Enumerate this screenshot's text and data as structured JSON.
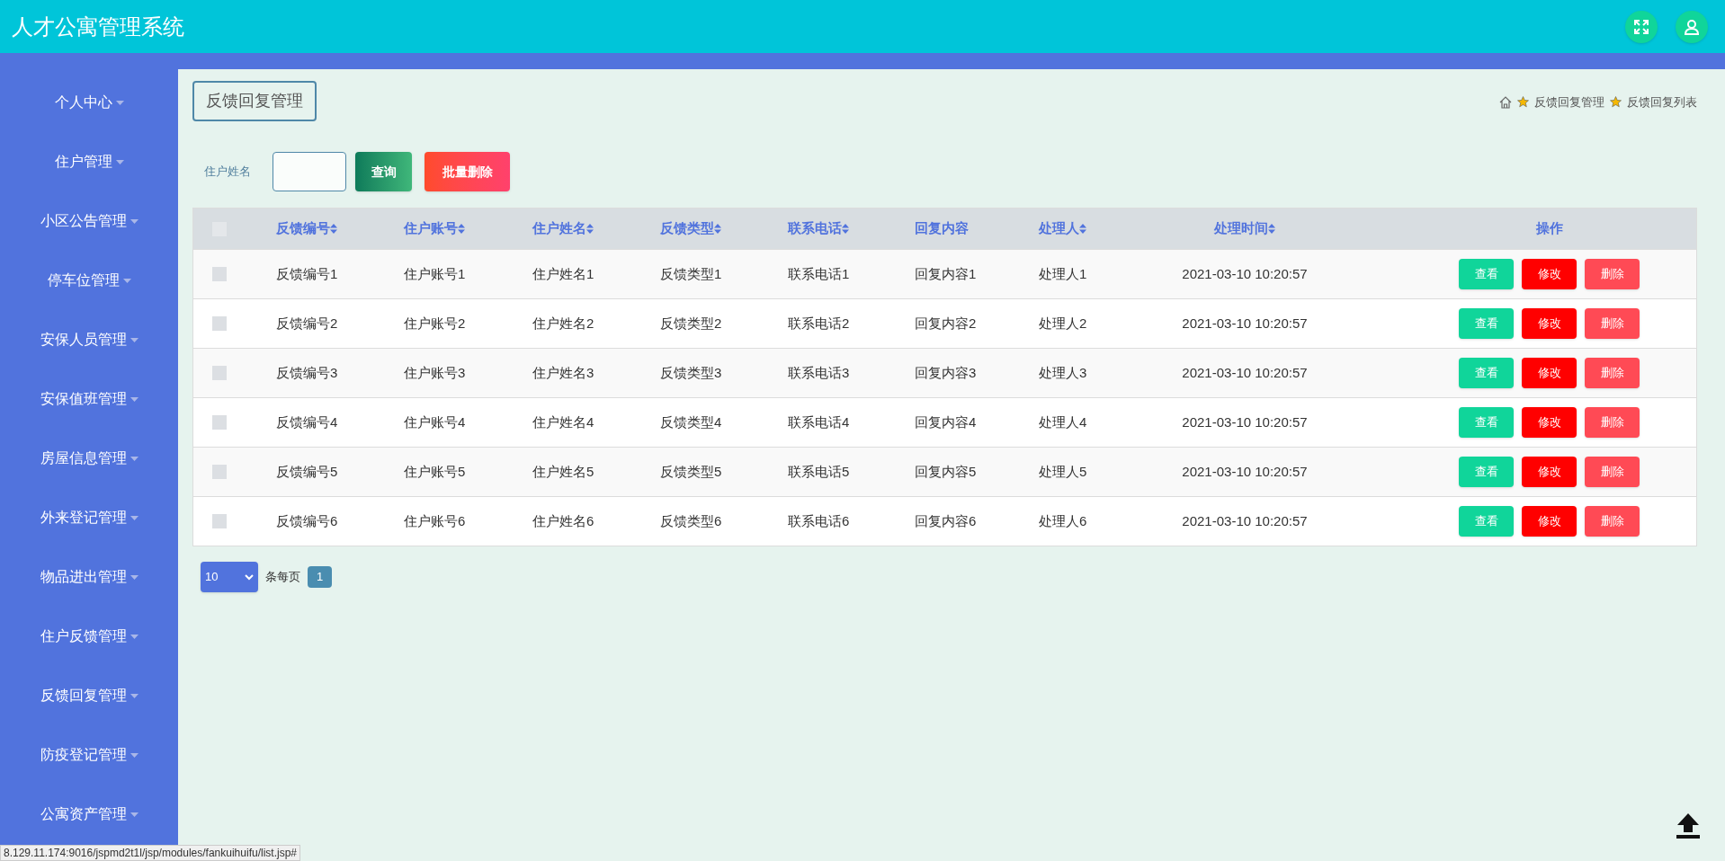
{
  "app_title": "人才公寓管理系统",
  "sidebar": {
    "items": [
      {
        "label": "个人中心"
      },
      {
        "label": "住户管理"
      },
      {
        "label": "小区公告管理"
      },
      {
        "label": "停车位管理"
      },
      {
        "label": "安保人员管理"
      },
      {
        "label": "安保值班管理"
      },
      {
        "label": "房屋信息管理"
      },
      {
        "label": "外来登记管理"
      },
      {
        "label": "物品进出管理"
      },
      {
        "label": "住户反馈管理"
      },
      {
        "label": "反馈回复管理"
      },
      {
        "label": "防疫登记管理"
      },
      {
        "label": "公寓资产管理"
      }
    ]
  },
  "page_title": "反馈回复管理",
  "breadcrumb": [
    "反馈回复管理",
    "反馈回复列表"
  ],
  "search": {
    "label": "住户姓名",
    "buttons": [
      {
        "label": "查询",
        "kind": "search"
      },
      {
        "label": "批量删除",
        "kind": "delete"
      }
    ]
  },
  "table": {
    "select_all_checked": false,
    "columns": [
      {
        "label": "反馈编号",
        "sortable": true
      },
      {
        "label": "住户账号",
        "sortable": true
      },
      {
        "label": "住户姓名",
        "sortable": true
      },
      {
        "label": "反馈类型",
        "sortable": true
      },
      {
        "label": "联系电话",
        "sortable": true
      },
      {
        "label": "回复内容",
        "sortable": false
      },
      {
        "label": "处理人",
        "sortable": true
      },
      {
        "label": "处理时间",
        "sortable": true
      },
      {
        "label": "操作",
        "sortable": false
      }
    ],
    "rows": [
      {
        "checked": false,
        "cells": [
          "反馈编号1",
          "住户账号1",
          "住户姓名1",
          "反馈类型1",
          "联系电话1",
          "回复内容1",
          "处理人1",
          "2021-03-10 10:20:57"
        ],
        "actions": [
          {
            "label": "查看",
            "kind": "view"
          },
          {
            "label": "修改",
            "kind": "edit"
          },
          {
            "label": "删除",
            "kind": "delete"
          }
        ]
      },
      {
        "checked": false,
        "cells": [
          "反馈编号2",
          "住户账号2",
          "住户姓名2",
          "反馈类型2",
          "联系电话2",
          "回复内容2",
          "处理人2",
          "2021-03-10 10:20:57"
        ],
        "actions": [
          {
            "label": "查看",
            "kind": "view"
          },
          {
            "label": "修改",
            "kind": "edit"
          },
          {
            "label": "删除",
            "kind": "delete"
          }
        ]
      },
      {
        "checked": false,
        "cells": [
          "反馈编号3",
          "住户账号3",
          "住户姓名3",
          "反馈类型3",
          "联系电话3",
          "回复内容3",
          "处理人3",
          "2021-03-10 10:20:57"
        ],
        "actions": [
          {
            "label": "查看",
            "kind": "view"
          },
          {
            "label": "修改",
            "kind": "edit"
          },
          {
            "label": "删除",
            "kind": "delete"
          }
        ]
      },
      {
        "checked": false,
        "cells": [
          "反馈编号4",
          "住户账号4",
          "住户姓名4",
          "反馈类型4",
          "联系电话4",
          "回复内容4",
          "处理人4",
          "2021-03-10 10:20:57"
        ],
        "actions": [
          {
            "label": "查看",
            "kind": "view"
          },
          {
            "label": "修改",
            "kind": "edit"
          },
          {
            "label": "删除",
            "kind": "delete"
          }
        ]
      },
      {
        "checked": false,
        "cells": [
          "反馈编号5",
          "住户账号5",
          "住户姓名5",
          "反馈类型5",
          "联系电话5",
          "回复内容5",
          "处理人5",
          "2021-03-10 10:20:57"
        ],
        "actions": [
          {
            "label": "查看",
            "kind": "view"
          },
          {
            "label": "修改",
            "kind": "edit"
          },
          {
            "label": "删除",
            "kind": "delete"
          }
        ]
      },
      {
        "checked": false,
        "cells": [
          "反馈编号6",
          "住户账号6",
          "住户姓名6",
          "反馈类型6",
          "联系电话6",
          "回复内容6",
          "处理人6",
          "2021-03-10 10:20:57"
        ],
        "actions": [
          {
            "label": "查看",
            "kind": "view"
          },
          {
            "label": "修改",
            "kind": "edit"
          },
          {
            "label": "删除",
            "kind": "delete"
          }
        ]
      }
    ]
  },
  "pagination": {
    "page_size": "10",
    "per_page_label": "条每页",
    "pages": [
      {
        "label": "1",
        "selected": true
      }
    ]
  },
  "status_url": "8.129.11.174:9016/jspmd2t1l/jsp/modules/fankuihuifu/list.jsp#"
}
